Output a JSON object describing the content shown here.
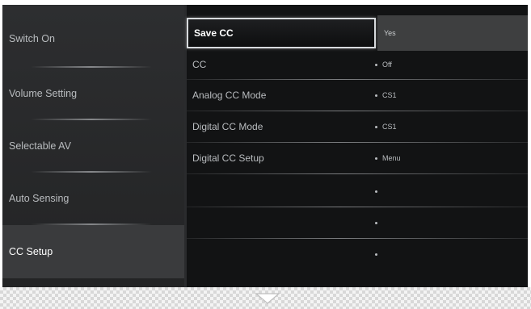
{
  "left_menu": {
    "items": [
      {
        "label": "Switch On"
      },
      {
        "label": "Volume Setting"
      },
      {
        "label": "Selectable AV"
      },
      {
        "label": "Auto Sensing"
      },
      {
        "label": "CC Setup"
      }
    ],
    "selected_index": 4
  },
  "right_menu": {
    "header": {
      "label": "Save CC",
      "value": "Yes"
    },
    "rows": [
      {
        "label": "CC",
        "value": "Off"
      },
      {
        "label": "Analog CC Mode",
        "value": "CS1"
      },
      {
        "label": "Digital CC Mode",
        "value": "CS1"
      },
      {
        "label": "Digital CC Setup",
        "value": "Menu"
      },
      {
        "label": "",
        "value": ""
      },
      {
        "label": "",
        "value": ""
      },
      {
        "label": "",
        "value": ""
      }
    ]
  },
  "footer": {
    "icon": "chevron-down-icon"
  },
  "colors": {
    "background": "#121314",
    "left_panel": "#2d2e30",
    "selected_item": "#3a3b3d",
    "highlight_border": "#d7dadd",
    "value_highlight": "#3e3f40",
    "text": "#b9bcbf"
  }
}
